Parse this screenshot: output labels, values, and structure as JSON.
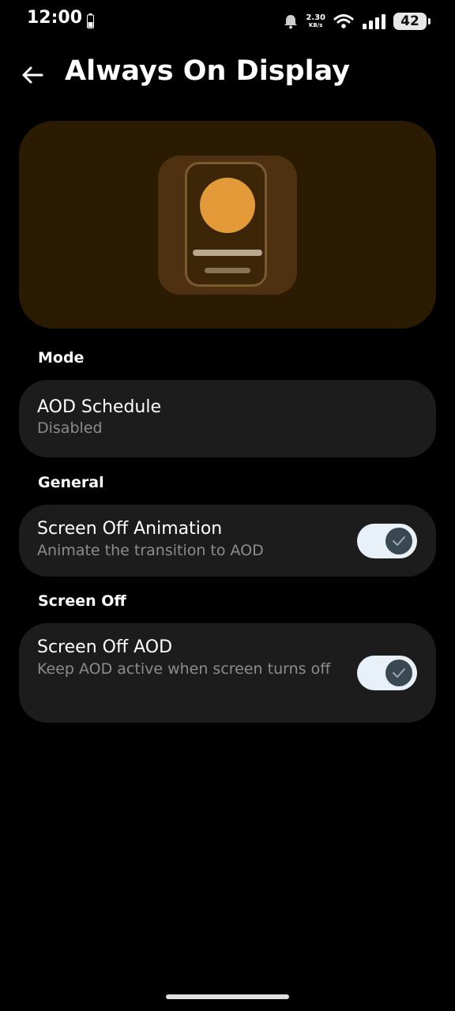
{
  "status_bar": {
    "time": "12:00",
    "net_speed_value": "2.30",
    "net_speed_unit": "KB/s",
    "battery": "42",
    "icons": [
      "battery-low-icon",
      "alarm-icon",
      "wifi-icon",
      "signal-icon"
    ]
  },
  "app_bar": {
    "back_icon": "arrow-left-icon",
    "title": "Always On Display"
  },
  "colors": {
    "background": "#000000",
    "card": "#1c1c1c",
    "hero_bg": "#2b1b02",
    "accent_orange": "#e59a3a",
    "toggle_track": "#e7f1f7",
    "toggle_knob": "#3a4852",
    "secondary_text": "#8c8c8c"
  },
  "sections": {
    "mode": {
      "label": "Mode",
      "aod_schedule": {
        "title": "AOD Schedule",
        "subtitle": "Disabled"
      }
    },
    "general": {
      "label": "General",
      "screen_off_animation": {
        "title": "Screen Off Animation",
        "subtitle": "Animate the transition to AOD",
        "enabled": true
      }
    },
    "screen_off": {
      "label": "Screen Off",
      "screen_off_aod": {
        "title": "Screen Off AOD",
        "subtitle": "Keep AOD active when screen turns off",
        "enabled": true
      }
    }
  }
}
